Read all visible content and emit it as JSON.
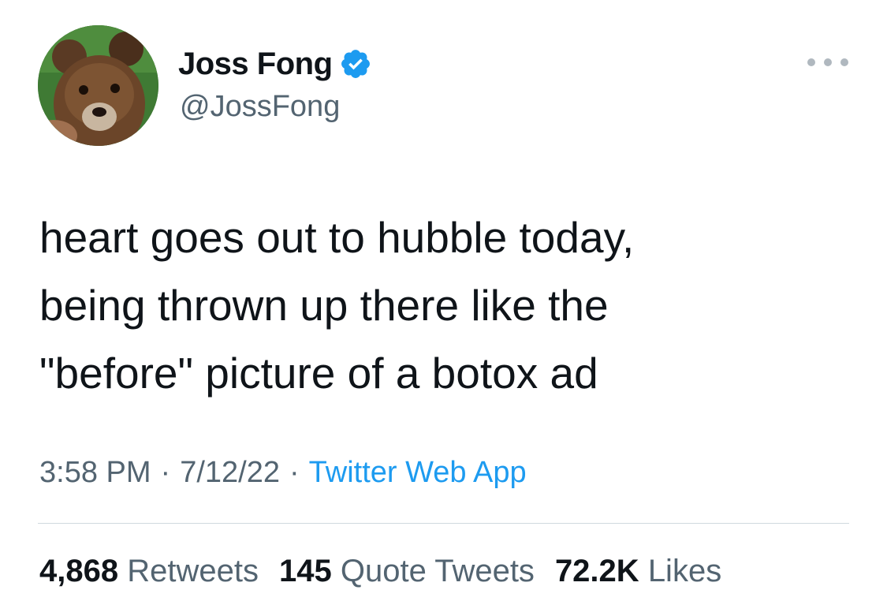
{
  "author": {
    "display_name": "Joss Fong",
    "handle": "@JossFong",
    "verified": true,
    "avatar": "bear-photo"
  },
  "tweet": {
    "text": "heart goes out to hubble today,\nbeing thrown up there like the\n\"before\" picture of a botox ad",
    "time": "3:58 PM",
    "date": "7/12/22",
    "source": "Twitter Web App",
    "separator": "·"
  },
  "stats": {
    "retweets_count": "4,868",
    "retweets_label": "Retweets",
    "quotes_count": "145",
    "quotes_label": "Quote Tweets",
    "likes_count": "72.2K",
    "likes_label": "Likes"
  },
  "icons": {
    "verified": "verified-badge-icon",
    "more": "more-options-icon"
  },
  "colors": {
    "text_primary": "#0f1419",
    "text_secondary": "#536471",
    "link": "#1d9bf0",
    "verified": "#1d9bf0",
    "divider": "#cfd9de"
  }
}
